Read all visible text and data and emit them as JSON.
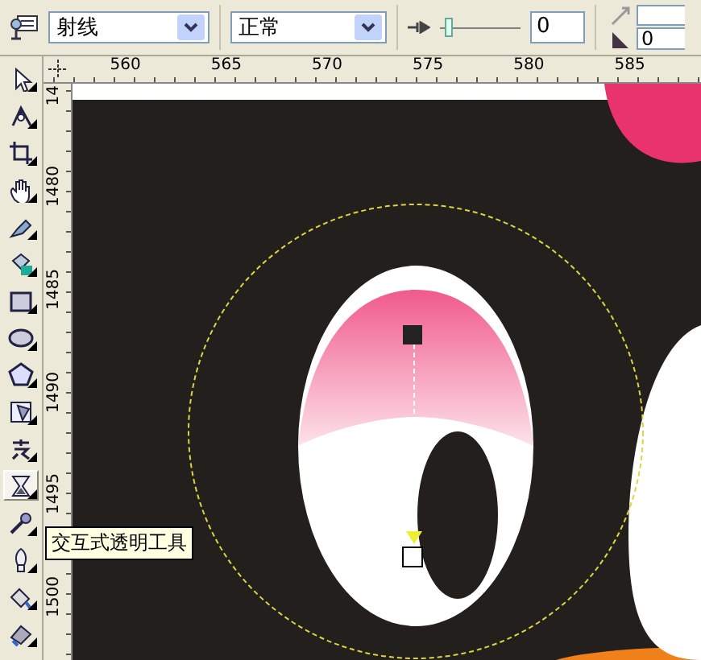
{
  "property_bar": {
    "fill_type": "射线",
    "merge_mode": "正常",
    "slider": {
      "level": 0.06
    },
    "slider_value": "0",
    "angle_value": "0"
  },
  "horizontal_ruler": {
    "labels": [
      "560",
      "565",
      "570",
      "575",
      "580",
      "585"
    ]
  },
  "vertical_ruler": {
    "labels": [
      "14",
      "1480",
      "1485",
      "1490",
      "1495",
      "1500"
    ]
  },
  "toolbox": {
    "tools": [
      {
        "selected": false
      },
      {
        "selected": false
      },
      {
        "selected": false
      },
      {
        "selected": false
      },
      {
        "selected": false
      },
      {
        "selected": false
      },
      {
        "selected": false
      },
      {
        "selected": false
      },
      {
        "selected": false
      },
      {
        "selected": false
      },
      {
        "selected": false
      },
      {
        "selected": true
      },
      {
        "selected": false
      },
      {
        "selected": false
      },
      {
        "selected": false
      },
      {
        "selected": false
      }
    ]
  },
  "tooltip": "交互式透明工具"
}
